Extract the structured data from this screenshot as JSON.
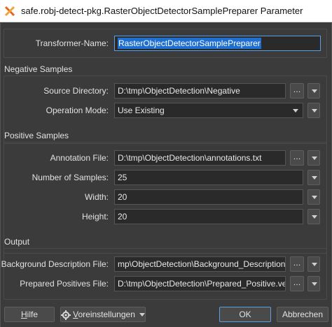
{
  "window": {
    "title": "safe.robj-detect-pkg.RasterObjectDetectorSamplePreparer Parameter",
    "icon": "fme-app-icon"
  },
  "transformer": {
    "label": "Transformer-Name:",
    "value": "RasterObjectDetectorSamplePreparer"
  },
  "negative": {
    "title": "Negative Samples",
    "source_dir_label": "Source Directory:",
    "source_dir_value": "D:\\tmp\\ObjectDetection\\Negative",
    "op_mode_label": "Operation Mode:",
    "op_mode_value": "Use Existing"
  },
  "positive": {
    "title": "Positive Samples",
    "annotation_label": "Annotation File:",
    "annotation_value": "D:\\tmp\\ObjectDetection\\annotations.txt",
    "num_samples_label": "Number of Samples:",
    "num_samples_value": "25",
    "width_label": "Width:",
    "width_value": "20",
    "height_label": "Height:",
    "height_value": "20"
  },
  "output": {
    "title": "Output",
    "bg_desc_label": "Background Description File:",
    "bg_desc_value": "mp\\ObjectDetection\\Background_Description.txt",
    "prep_pos_label": "Prepared Positives File:",
    "prep_pos_value": "D:\\tmp\\ObjectDetection\\Prepared_Positive.vec"
  },
  "buttons": {
    "ellipsis": "...",
    "help_mnemonic": "H",
    "help_rest": "ilfe",
    "defaults_mnemonic": "V",
    "defaults_rest": "oreinstellungen",
    "ok": "OK",
    "cancel": "Abbrechen"
  }
}
